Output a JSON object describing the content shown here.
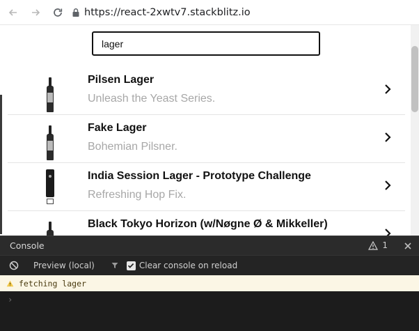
{
  "browser": {
    "url": "https://react-2xwtv7.stackblitz.io",
    "back_icon": "back-arrow-icon",
    "forward_icon": "forward-arrow-icon",
    "reload_icon": "reload-icon",
    "lock_icon": "lock-icon"
  },
  "search": {
    "value": "lager",
    "placeholder": ""
  },
  "beers": [
    {
      "name": "Pilsen Lager",
      "tagline": "Unleash the Yeast Series.",
      "image": "bottle"
    },
    {
      "name": "Fake Lager",
      "tagline": "Bohemian Pilsner.",
      "image": "bottle"
    },
    {
      "name": "India Session Lager - Prototype Challenge",
      "tagline": "Refreshing Hop Fix.",
      "image": "can"
    },
    {
      "name": "Black Tokyo Horizon (w/Nøgne Ø & Mikkeller)",
      "tagline": "",
      "image": "bottle"
    }
  ],
  "console": {
    "title": "Console",
    "warning_count": "1",
    "preview_label": "Preview (local)",
    "clear_on_reload_label": "Clear console on reload",
    "clear_on_reload_checked": true,
    "messages": [
      {
        "level": "warning",
        "text": "fetching lager"
      }
    ],
    "prompt": "›"
  },
  "colors": {
    "console_bg": "#1c1c1c",
    "warning_bg": "#fbf6e5",
    "subtitle_gray": "#a7a7a7"
  }
}
